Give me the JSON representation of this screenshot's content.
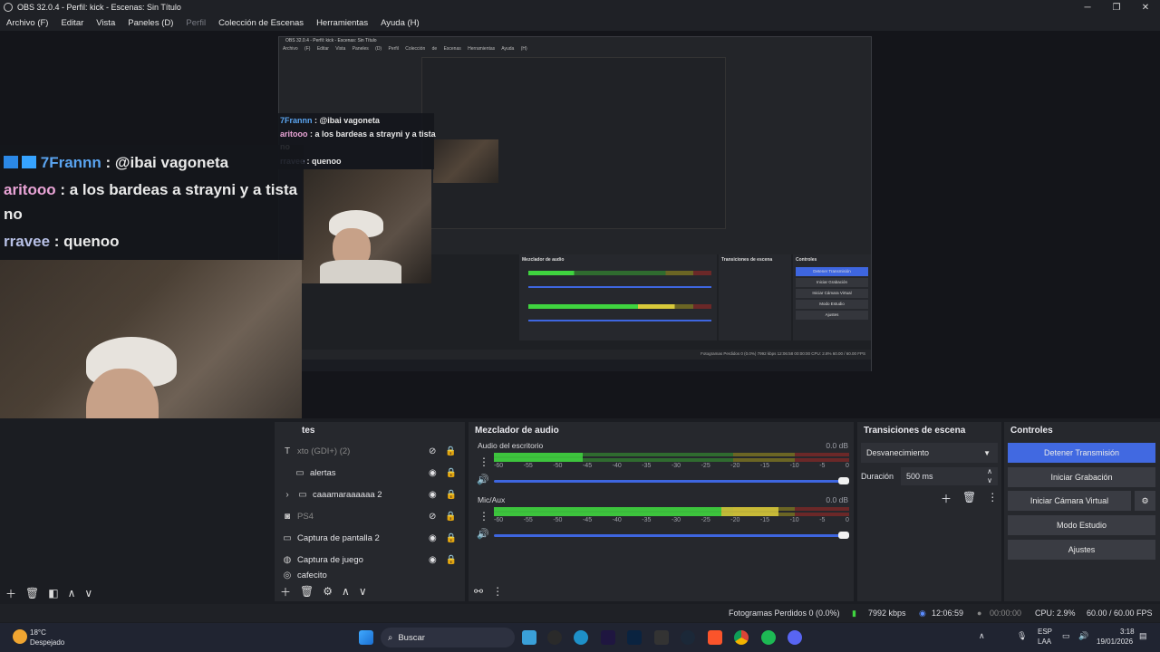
{
  "window": {
    "title": "OBS 32.0.4 - Perfil: kick - Escenas: Sin Título",
    "controls": [
      "─",
      "❐",
      "✕"
    ]
  },
  "menu": {
    "items": [
      "Archivo (F)",
      "Editar",
      "Vista",
      "Paneles (D)",
      "Perfil",
      "Colección de Escenas",
      "Herramientas",
      "Ayuda (H)"
    ]
  },
  "chat": {
    "messages": [
      {
        "user": "7Frannn",
        "text": ": @ibai vagoneta"
      },
      {
        "user": "aritooo",
        "text": ": a los bardeas a strayni y a tista"
      },
      {
        "user": "",
        "text": "no"
      },
      {
        "user": "rravee",
        "text": ": quenoo"
      }
    ]
  },
  "sources": {
    "items": [
      {
        "label": "xto (GDI+) (2)",
        "icon": "text-icon",
        "visible": false,
        "dim": true
      },
      {
        "label": "alertas",
        "icon": "folder-icon",
        "visible": true,
        "dim": false
      },
      {
        "label": "caaamaraaaaaa 2",
        "icon": "folder-icon",
        "visible": true,
        "dim": false
      },
      {
        "label": "PS4",
        "icon": "camera-icon",
        "visible": false,
        "dim": true
      },
      {
        "label": "Captura de pantalla 2",
        "icon": "monitor-icon",
        "visible": true,
        "dim": false
      },
      {
        "label": "Captura de juego",
        "icon": "gamepad-icon",
        "visible": true,
        "dim": false
      },
      {
        "label": "cafecito",
        "icon": "globe-icon",
        "visible": true,
        "dim": false
      }
    ],
    "head_partial": "tes"
  },
  "mixer": {
    "title": "Mezclador de audio",
    "tracks": [
      {
        "name": "Audio del escritorio",
        "db": "0.0 dB",
        "level": 0.25
      },
      {
        "name": "Mic/Aux",
        "db": "0.0 dB",
        "level": 0.8
      }
    ],
    "ticks": [
      "-60",
      "-55",
      "-50",
      "-45",
      "-40",
      "-35",
      "-30",
      "-25",
      "-20",
      "-15",
      "-10",
      "-5",
      "0"
    ]
  },
  "transitions": {
    "title": "Transiciones de escena",
    "selected": "Desvanecimiento",
    "duration_label": "Duración",
    "duration_value": "500 ms"
  },
  "controls": {
    "title": "Controles",
    "buttons": [
      "Detener Transmisión",
      "Iniciar Grabación",
      "Iniciar Cámara Virtual",
      "Modo Estudio",
      "Ajustes"
    ]
  },
  "status": {
    "dropped": "Fotogramas Perdidos 0 (0.0%)",
    "bitrate": "7992 kbps",
    "stream_time": "12:06:59",
    "rec_time": "00:00:00",
    "cpu": "CPU: 2.9%",
    "fps": "60.00 / 60.00 FPS"
  },
  "taskbar": {
    "weather_temp": "18°C",
    "weather_desc": "Despejado",
    "search": "Buscar",
    "lang1": "ESP",
    "lang2": "LAA",
    "time": "3:18",
    "date": "19/01/2026"
  },
  "inner": {
    "title": "OBS 32.0.4 - Perfil: kick - Escenas: Sin Título",
    "menu": "Archivo (F) Editar Vista Paneles (D) Perfil Colección de Escenas Herramientas Ayuda (H)",
    "status": "Fotogramas Perdidos 0 (0.0%)   7992 kbps   12:06:58   00:00:00   CPU: 2.8%   60.00 / 60.00 FPS",
    "mixer_title": "Mezclador de audio",
    "transitions_title": "Transiciones de escena",
    "controls_title": "Controles",
    "chat": [
      {
        "user": "7Frannn",
        "text": ": @ibai vagoneta"
      },
      {
        "user": "aritooo",
        "text": ": a los bardeas a strayni y a tista"
      },
      {
        "user": "",
        "text": "no"
      },
      {
        "user": "rravee",
        "text": ": quenoo"
      }
    ]
  },
  "colors": {
    "accent": "#4169e1",
    "meter_green": "#3fd43f",
    "meter_yellow": "#d8c93a",
    "meter_red": "#d63b3b"
  }
}
